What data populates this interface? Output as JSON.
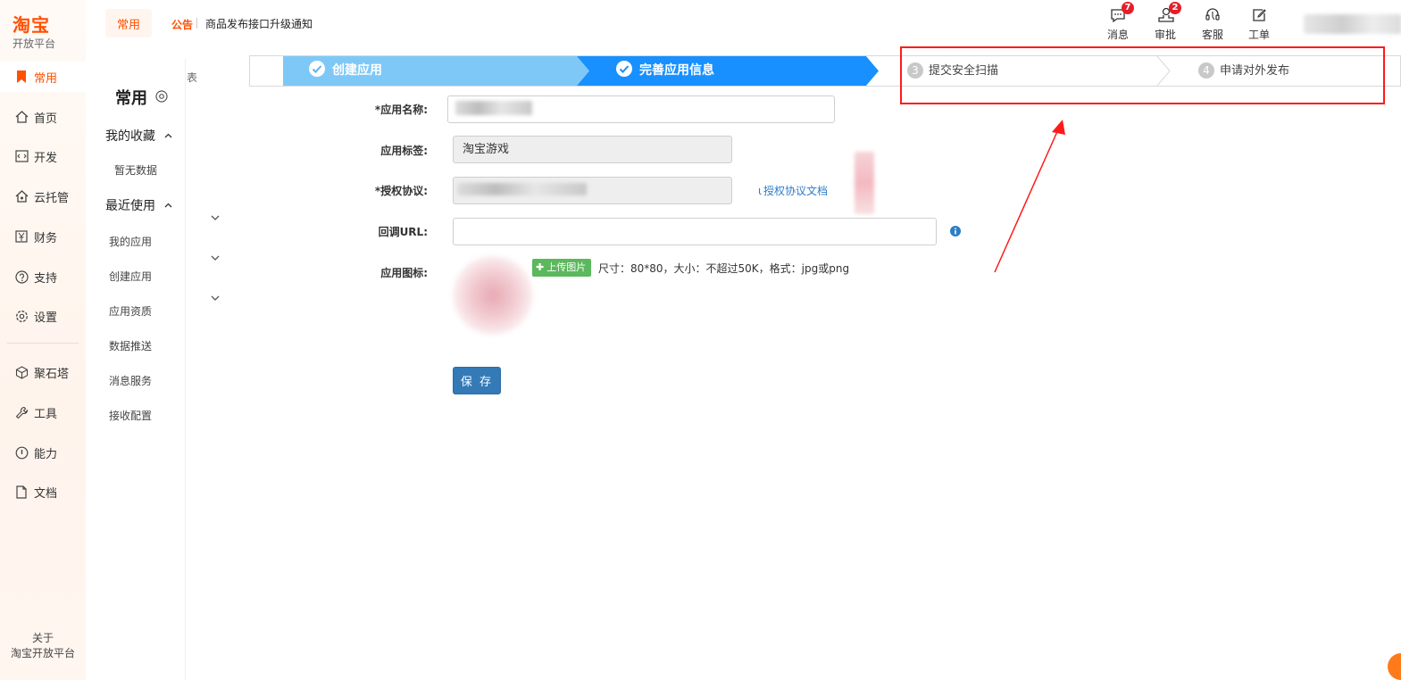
{
  "brand": {
    "logo": "淘宝",
    "subtitle": "开放平台"
  },
  "leftnav": {
    "items": [
      {
        "label": "常用",
        "icon": "bookmark-icon"
      },
      {
        "label": "首页",
        "icon": "home-icon"
      },
      {
        "label": "开发",
        "icon": "code-icon"
      },
      {
        "label": "云托管",
        "icon": "cloud-icon"
      },
      {
        "label": "财务",
        "icon": "yuan-icon"
      },
      {
        "label": "支持",
        "icon": "question-icon"
      },
      {
        "label": "设置",
        "icon": "gear-icon"
      },
      {
        "label": "聚石塔",
        "icon": "cube-icon"
      },
      {
        "label": "工具",
        "icon": "wrench-icon"
      },
      {
        "label": "能力",
        "icon": "power-icon"
      },
      {
        "label": "文档",
        "icon": "document-icon"
      }
    ],
    "about_line1": "关于",
    "about_line2": "淘宝开放平台"
  },
  "subnav": {
    "title": "常用",
    "favorites_label": "我的收藏",
    "favorites_empty": "暂无数据",
    "recent_label": "最近使用",
    "recent_items": [
      "我的应用",
      "创建应用",
      "应用资质",
      "数据推送",
      "消息服务",
      "接收配置"
    ]
  },
  "collapsed_col": {
    "partial_text": "表"
  },
  "header": {
    "active_tab": "常用",
    "notice_label": "公告",
    "notice_text": "商品发布接口升级通知",
    "actions": [
      {
        "label": "消息",
        "badge": "7",
        "icon": "message-icon"
      },
      {
        "label": "审批",
        "badge": "2",
        "icon": "approval-icon"
      },
      {
        "label": "客服",
        "icon": "headset-icon"
      },
      {
        "label": "工单",
        "icon": "ticket-icon"
      }
    ]
  },
  "steps": [
    {
      "label": "创建应用",
      "state": "done"
    },
    {
      "label": "完善应用信息",
      "state": "current"
    },
    {
      "num": "3",
      "label": "提交安全扫描",
      "state": "todo"
    },
    {
      "num": "4",
      "label": "申请对外发布",
      "state": "todo"
    }
  ],
  "form": {
    "name_label": "*应用名称:",
    "tag_label": "应用标签:",
    "tag_value": "淘宝游戏",
    "license_label": "*授权协议:",
    "license_link": "授权协议文档",
    "callback_label": "回调URL:",
    "callback_value": "",
    "icon_label": "应用图标:",
    "upload_label": "上传图片",
    "upload_hint": "尺寸：80*80，大小：不超过50K，格式：jpg或png",
    "save_label": "保 存"
  },
  "colors": {
    "brand_orange": "#ff5000",
    "step_done": "#7ec8f7",
    "step_current": "#1890ff",
    "save_blue": "#337ab7",
    "upload_green": "#5cb85c",
    "annotation_red": "#ff1a1a"
  }
}
